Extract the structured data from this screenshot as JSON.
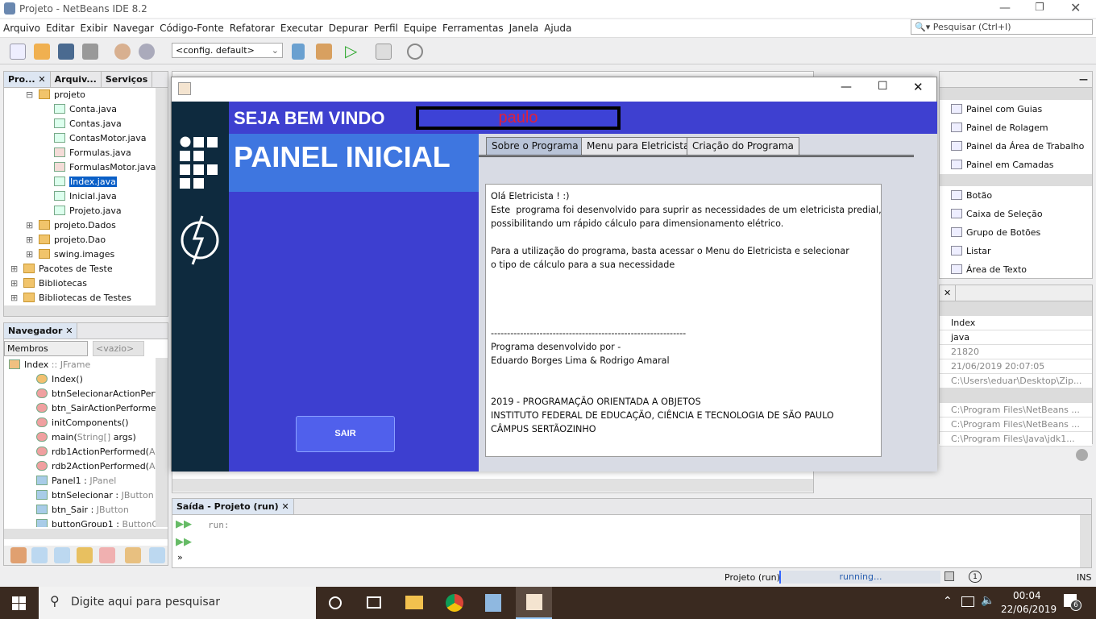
{
  "window": {
    "title": "Projeto - NetBeans IDE 8.2"
  },
  "menu": [
    "Arquivo",
    "Editar",
    "Exibir",
    "Navegar",
    "Código-Fonte",
    "Refatorar",
    "Executar",
    "Depurar",
    "Perfil",
    "Equipe",
    "Ferramentas",
    "Janela",
    "Ajuda"
  ],
  "search": {
    "placeholder": "Pesquisar (Ctrl+I)"
  },
  "toolbar": {
    "config": "<config. default>"
  },
  "projects": {
    "tabs": [
      "Pro...",
      "Arquiv...",
      "Serviços"
    ],
    "items": [
      {
        "label": "projeto",
        "type": "package",
        "level": 1
      },
      {
        "label": "Conta.java",
        "type": "java",
        "level": 2
      },
      {
        "label": "Contas.java",
        "type": "java",
        "level": 2
      },
      {
        "label": "ContasMotor.java",
        "type": "java",
        "level": 2
      },
      {
        "label": "Formulas.java",
        "type": "form",
        "level": 2
      },
      {
        "label": "FormulasMotor.java",
        "type": "form",
        "level": 2
      },
      {
        "label": "Index.java",
        "type": "java",
        "level": 2,
        "selected": true
      },
      {
        "label": "Inicial.java",
        "type": "java",
        "level": 2
      },
      {
        "label": "Projeto.java",
        "type": "main",
        "level": 2
      },
      {
        "label": "projeto.Dados",
        "type": "package",
        "level": 1
      },
      {
        "label": "projeto.Dao",
        "type": "package",
        "level": 1
      },
      {
        "label": "swing.images",
        "type": "package",
        "level": 1
      },
      {
        "label": "Pacotes de Teste",
        "type": "folder",
        "level": 0
      },
      {
        "label": "Bibliotecas",
        "type": "folder",
        "level": 0
      },
      {
        "label": "Bibliotecas de Testes",
        "type": "folder",
        "level": 0
      }
    ]
  },
  "navigator": {
    "title": "Navegador",
    "filter": "Membros",
    "empty": "<vazio>",
    "root": "Index",
    "root_type": ":: JFrame",
    "items": [
      {
        "name": "Index()",
        "type": ""
      },
      {
        "name": "btnSelecionarActionPerfor",
        "type": ""
      },
      {
        "name": "btn_SairActionPerformed(",
        "type": ""
      },
      {
        "name": "initComponents()",
        "type": ""
      },
      {
        "name": "main(",
        "type": "String[]",
        "extra": " args)"
      },
      {
        "name": "rdb1ActionPerformed(",
        "type": "Acti"
      },
      {
        "name": "rdb2ActionPerformed(",
        "type": "Acti"
      },
      {
        "name": "Panel1 : ",
        "type": "JPanel"
      },
      {
        "name": "btnSelecionar : ",
        "type": "JButton"
      },
      {
        "name": "btn_Sair : ",
        "type": "JButton"
      },
      {
        "name": "buttonGroup1 : ",
        "type": "ButtonGro"
      }
    ]
  },
  "app": {
    "welcome": "SEJA BEM VINDO",
    "user": "paulo",
    "panel_title": "PAINEL INICIAL",
    "exit_button": "SAIR",
    "tabs": [
      "Sobre o Programa",
      "Menu para Eletricista",
      "Criação do Programa"
    ],
    "about_text": "Olá Eletricista ! :)\nEste  programa foi desenvolvido para suprir as necessidades de um eletricista predial,\npossibilitando um rápido cálculo para dimensionamento elétrico.\n\nPara a utilização do programa, basta acessar o Menu do Eletricista e selecionar\no tipo de cálculo para a sua necessidade\n\n\n\n\n------------------------------------------------------------\nPrograma desenvolvido por -\nEduardo Borges Lima & Rodrigo Amaral\n\n\n2019 - PROGRAMAÇÃO ORIENTADA A OBJETOS\nINSTITUTO FEDERAL DE EDUCAÇÃO, CIÊNCIA E TECNOLOGIA DE SÃO PAULO\nCÂMPUS SERTÃOZINHO",
    "colors": {
      "navy": "#0e2a3e",
      "header": "#3e40d0",
      "panel_top": "#3e76e0",
      "name": "#e0203a"
    }
  },
  "palette": {
    "items": [
      "Painel com Guias",
      "Painel de Rolagem",
      "Painel da Área de Trabalho",
      "Painel em Camadas",
      "Botão",
      "Caixa de Seleção",
      "Grupo de Botões",
      "Listar",
      "Área de Texto"
    ]
  },
  "properties": {
    "values": [
      "Index",
      "java",
      "21820",
      "21/06/2019 20:07:05",
      "C:\\Users\\eduar\\Desktop\\Zip...",
      "C:\\Program Files\\NetBeans ...",
      "C:\\Program Files\\NetBeans ...",
      "C:\\Program Files\\Java\\jdk1..."
    ]
  },
  "output": {
    "title": "Saída - Projeto (run)",
    "text": "run:"
  },
  "status": {
    "project": "Projeto (run)",
    "progress": "running...",
    "notifications": "1",
    "mode": "INS"
  },
  "taskbar": {
    "search": "Digite aqui para pesquisar",
    "time": "00:04",
    "date": "22/06/2019",
    "notif_count": "6"
  }
}
